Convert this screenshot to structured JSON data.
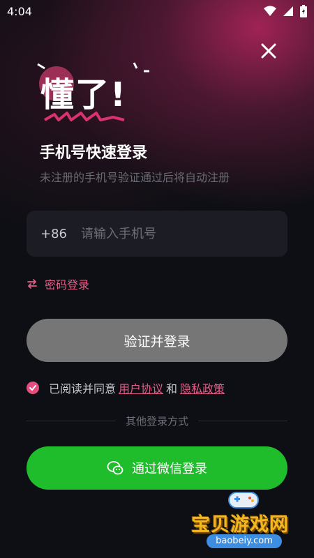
{
  "status_bar": {
    "time": "4:04"
  },
  "logo": {
    "text": "懂了!"
  },
  "header": {
    "title": "手机号快速登录",
    "subtitle": "未注册的手机号验证通过后将自动注册"
  },
  "phone": {
    "country_code": "+86",
    "placeholder": "请输入手机号",
    "value": ""
  },
  "password_login": {
    "label": "密码登录"
  },
  "login_button": {
    "label": "验证并登录"
  },
  "agreement": {
    "prefix": "已阅读并同意",
    "user_agreement": "用户协议",
    "and": "和",
    "privacy_policy": "隐私政策",
    "checked": true
  },
  "divider": {
    "label": "其他登录方式"
  },
  "wechat_button": {
    "label": "通过微信登录"
  },
  "watermark": {
    "text": "宝贝游戏网",
    "url": "baobeiy.com"
  },
  "colors": {
    "accent_pink": "#e45d86",
    "wechat_green": "#1fbd2b",
    "disabled_button": "#767676",
    "background": "#0e0f14"
  }
}
